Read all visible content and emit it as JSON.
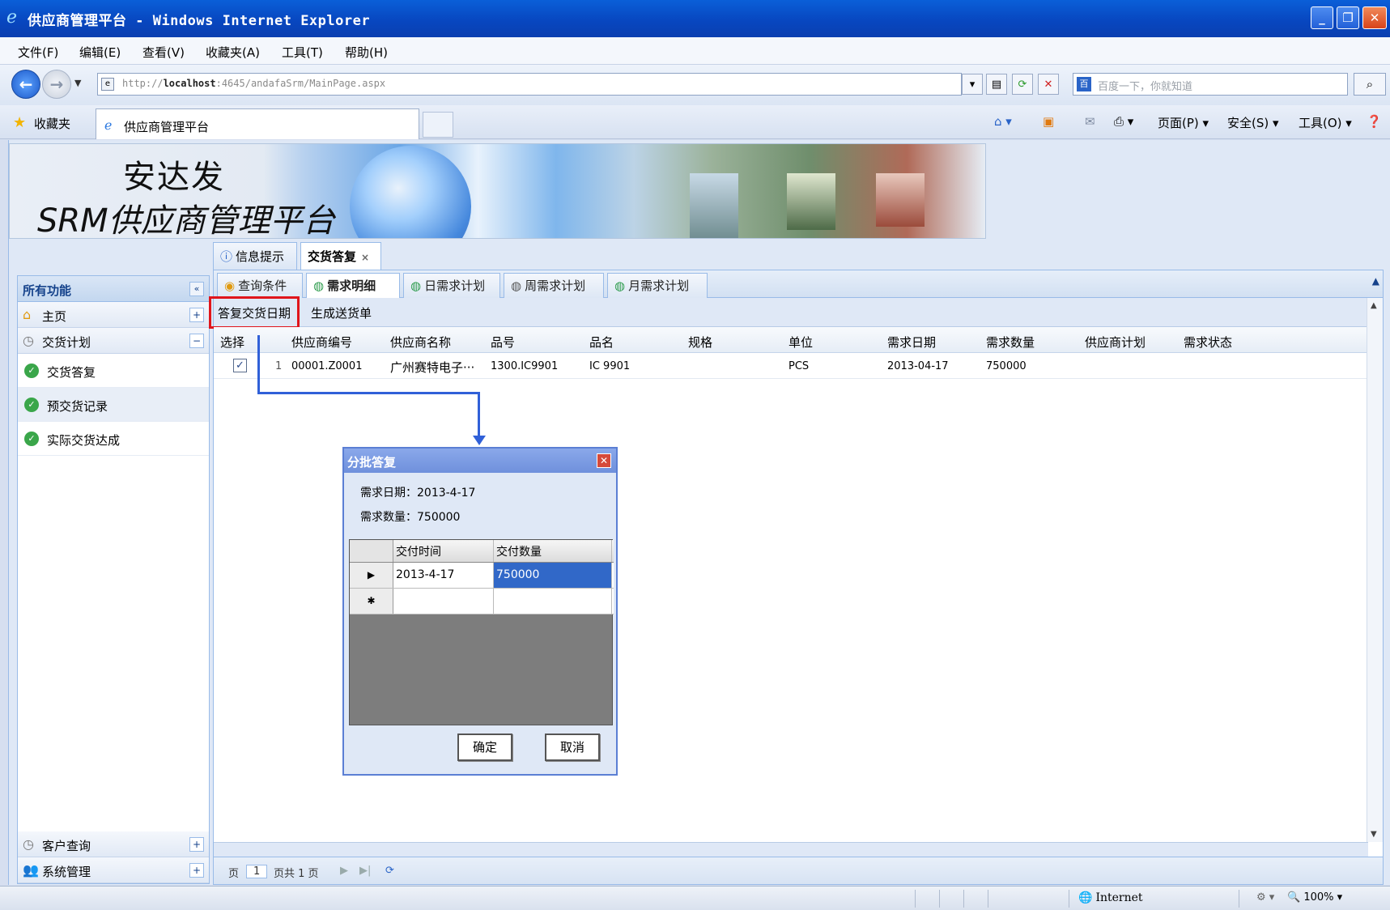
{
  "window": {
    "title": "供应商管理平台 - Windows Internet Explorer",
    "minimize": "_",
    "maximize": "❐",
    "close": "✕"
  },
  "menu": [
    "文件(F)",
    "编辑(E)",
    "查看(V)",
    "收藏夹(A)",
    "工具(T)",
    "帮助(H)"
  ],
  "address": {
    "url_prefix": "http://",
    "url_host": "localhost",
    "url_rest": ":4645/andafaSrm/MainPage.aspx",
    "search_placeholder": "百度一下，你就知道"
  },
  "favorites": {
    "label": "收藏夹",
    "tab_title": "供应商管理平台",
    "commands": [
      "页面(P) ▾",
      "安全(S) ▾",
      "工具(O) ▾",
      "❓▾"
    ]
  },
  "banner": {
    "line1": "安达发",
    "line2": "SRM供应商管理平台"
  },
  "top_tabs": [
    {
      "label": "信息提示",
      "icon": "info-icon"
    },
    {
      "label": "交货答复",
      "icon": "",
      "closable": "×"
    }
  ],
  "sidebar": {
    "header": "所有功能",
    "collapse": "«",
    "sections": [
      {
        "label": "主页",
        "icon": "home-icon",
        "toggle": "+"
      },
      {
        "label": "交货计划",
        "icon": "expand-icon",
        "toggle": "−"
      }
    ],
    "items": [
      {
        "label": "交货答复"
      },
      {
        "label": "预交货记录"
      },
      {
        "label": "实际交货达成"
      }
    ],
    "bottom_sections": [
      {
        "label": "客户查询",
        "toggle": "+"
      },
      {
        "label": "系统管理",
        "toggle": "+"
      }
    ]
  },
  "sub_tabs": [
    "查询条件",
    "需求明细",
    "日需求计划",
    "周需求计划",
    "月需求计划"
  ],
  "toolbar": {
    "reply_date": "答复交货日期",
    "gen_delivery": "生成送货单"
  },
  "grid": {
    "columns": [
      "选择",
      "供应商编号",
      "供应商名称",
      "品号",
      "品名",
      "规格",
      "单位",
      "需求日期",
      "需求数量",
      "供应商计划",
      "需求状态"
    ],
    "rows": [
      {
        "checked": "✓",
        "index": "1",
        "supplier_code": "00001.Z0001",
        "supplier_name": "广州赛特电子···",
        "part_no": "1300.IC9901",
        "part_name": "IC 9901",
        "spec": "",
        "unit": "PCS",
        "req_date": "2013-04-17",
        "req_qty": "750000",
        "supplier_plan": "",
        "status": ""
      }
    ]
  },
  "pager": {
    "page_label": "页",
    "page_value": "1",
    "page_total": "页共 1 页"
  },
  "dialog": {
    "title": "分批答复",
    "close": "✕",
    "req_date_label": "需求日期：",
    "req_date": "2013-4-17",
    "req_qty_label": "需求数量：",
    "req_qty": "750000",
    "columns": [
      "交付时间",
      "交付数量"
    ],
    "rows": [
      {
        "marker": "▶",
        "time": "2013-4-17",
        "qty": "750000"
      },
      {
        "marker": "✱",
        "time": "",
        "qty": ""
      }
    ],
    "ok": "确定",
    "cancel": "取消"
  },
  "status": {
    "zone": "Internet",
    "zoom": "100%"
  },
  "colors": {
    "highlight_box": "#e0151b",
    "connector": "#3060d8",
    "selected_cell": "#3168c8"
  }
}
